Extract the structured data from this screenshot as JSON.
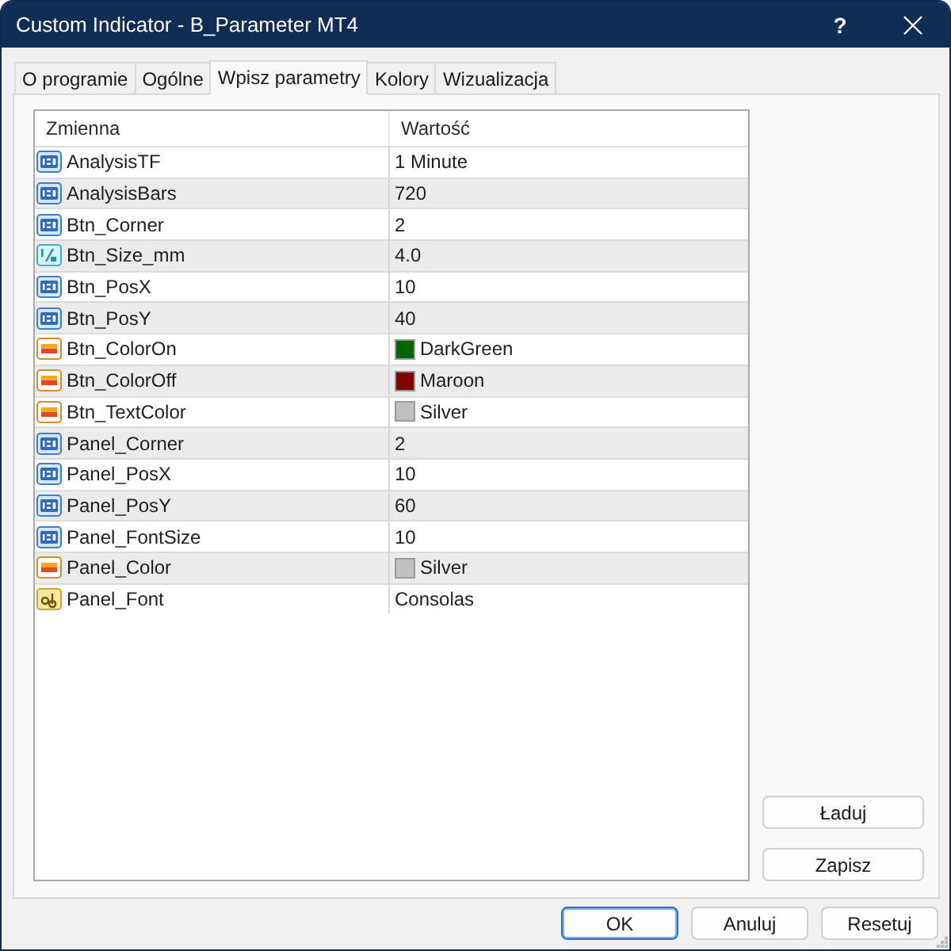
{
  "window": {
    "title": "Custom Indicator - B_Parameter MT4",
    "help_button": "?"
  },
  "tabs": [
    {
      "label": "O programie",
      "selected": false
    },
    {
      "label": "Ogólne",
      "selected": false
    },
    {
      "label": "Wpisz parametry",
      "selected": true
    },
    {
      "label": "Kolory",
      "selected": false
    },
    {
      "label": "Wizualizacja",
      "selected": false
    }
  ],
  "parameters": {
    "columns": [
      "Zmienna",
      "Wartość"
    ],
    "rows": [
      {
        "kind": "int",
        "name": "AnalysisTF",
        "value": "1 Minute"
      },
      {
        "kind": "int",
        "name": "AnalysisBars",
        "value": "720"
      },
      {
        "kind": "int",
        "name": "Btn_Corner",
        "value": "2"
      },
      {
        "kind": "double",
        "name": "Btn_Size_mm",
        "value": "4.0"
      },
      {
        "kind": "int",
        "name": "Btn_PosX",
        "value": "10"
      },
      {
        "kind": "int",
        "name": "Btn_PosY",
        "value": "40"
      },
      {
        "kind": "color",
        "name": "Btn_ColorOn",
        "value": "DarkGreen",
        "color": "#006400"
      },
      {
        "kind": "color",
        "name": "Btn_ColorOff",
        "value": "Maroon",
        "color": "#800000"
      },
      {
        "kind": "color",
        "name": "Btn_TextColor",
        "value": "Silver",
        "color": "#c0c0c0"
      },
      {
        "kind": "int",
        "name": "Panel_Corner",
        "value": "2"
      },
      {
        "kind": "int",
        "name": "Panel_PosX",
        "value": "10"
      },
      {
        "kind": "int",
        "name": "Panel_PosY",
        "value": "60"
      },
      {
        "kind": "int",
        "name": "Panel_FontSize",
        "value": "10"
      },
      {
        "kind": "color",
        "name": "Panel_Color",
        "value": "Silver",
        "color": "#c0c0c0"
      },
      {
        "kind": "string",
        "name": "Panel_Font",
        "value": "Consolas"
      }
    ]
  },
  "side_buttons": [
    "Ładuj",
    "Zapisz"
  ],
  "footer_buttons": [
    {
      "label": "OK",
      "focused": true
    },
    {
      "label": "Anuluj",
      "focused": false
    },
    {
      "label": "Resetuj",
      "focused": false
    }
  ]
}
